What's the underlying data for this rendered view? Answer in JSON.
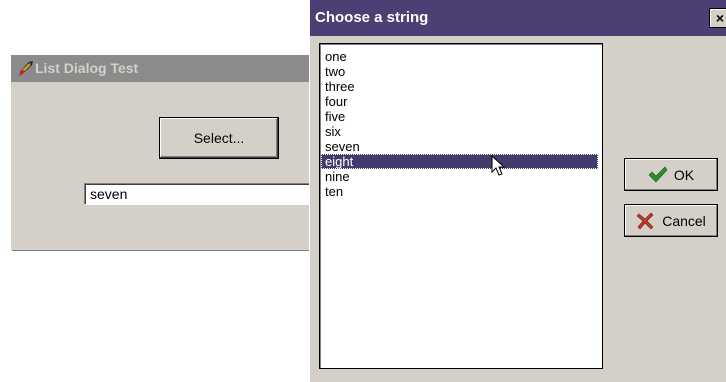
{
  "background_window": {
    "title": "List Dialog Test",
    "app_icon": "app-icon",
    "select_button_label": "Select...",
    "result_value": "seven"
  },
  "dialog": {
    "title": "Choose a string",
    "close_label": "×",
    "list": {
      "items": [
        "one",
        "two",
        "three",
        "four",
        "five",
        "six",
        "seven",
        "eight",
        "nine",
        "ten"
      ],
      "selected_index": 7
    },
    "ok_label": "OK",
    "ok_icon": "checkmark-icon",
    "cancel_label": "Cancel",
    "cancel_icon": "cross-icon"
  },
  "colors": {
    "dialog_titlebar": "#4b3f73",
    "inactive_titlebar": "#8b8b8b",
    "selection": "#433a6d",
    "window_face": "#d4d0c8"
  }
}
